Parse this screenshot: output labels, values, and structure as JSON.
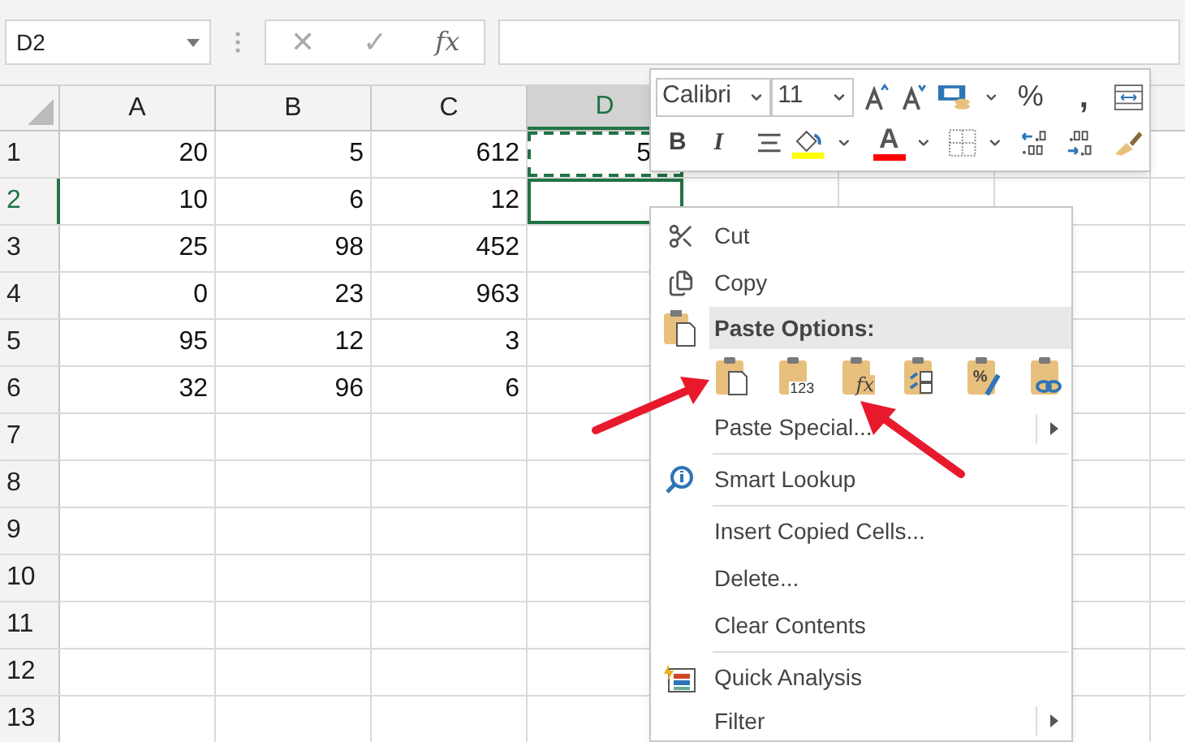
{
  "name_box": {
    "value": "D2"
  },
  "formula_bar": {
    "cancel": "✕",
    "enter": "✓",
    "function": "fx"
  },
  "columns": [
    {
      "label": "A",
      "selected": false
    },
    {
      "label": "B",
      "selected": false
    },
    {
      "label": "C",
      "selected": false
    },
    {
      "label": "D",
      "selected": true
    }
  ],
  "rows": [
    {
      "label": "1",
      "selected": false,
      "cells": [
        {
          "value": "20"
        },
        {
          "value": "5"
        },
        {
          "value": "612"
        },
        {
          "value": "5",
          "copied": true
        }
      ]
    },
    {
      "label": "2",
      "selected": true,
      "cells": [
        {
          "value": "10"
        },
        {
          "value": "6"
        },
        {
          "value": "12"
        },
        {
          "active": true
        }
      ]
    },
    {
      "label": "3",
      "selected": false,
      "cells": [
        {
          "value": "25"
        },
        {
          "value": "98"
        },
        {
          "value": "452"
        }
      ]
    },
    {
      "label": "4",
      "selected": false,
      "cells": [
        {
          "value": "0"
        },
        {
          "value": "23"
        },
        {
          "value": "963"
        }
      ]
    },
    {
      "label": "5",
      "selected": false,
      "cells": [
        {
          "value": "95"
        },
        {
          "value": "12"
        },
        {
          "value": "3"
        }
      ]
    },
    {
      "label": "6",
      "selected": false,
      "cells": [
        {
          "value": "32"
        },
        {
          "value": "96"
        },
        {
          "value": "6"
        }
      ]
    },
    {
      "label": "7",
      "selected": false
    },
    {
      "label": "8",
      "selected": false
    },
    {
      "label": "9",
      "selected": false
    },
    {
      "label": "10",
      "selected": false
    },
    {
      "label": "11",
      "selected": false
    },
    {
      "label": "12",
      "selected": false
    },
    {
      "label": "13",
      "selected": false
    }
  ],
  "mini_toolbar": {
    "font": "Calibri",
    "size": "11",
    "percent": "%",
    "comma": ",",
    "bold": "B",
    "italic": "I",
    "font_color": "A"
  },
  "context_menu": [
    {
      "kind": "cut",
      "label": "Cut"
    },
    {
      "kind": "copy",
      "label": "Copy"
    },
    {
      "kind": "header",
      "label": "Paste Options:"
    },
    {
      "kind": "paste_options",
      "options": [
        {
          "kind": "paste"
        },
        {
          "kind": "values",
          "glyph": "123"
        },
        {
          "kind": "formulas",
          "glyph": "fx"
        },
        {
          "kind": "transpose"
        },
        {
          "kind": "formatting",
          "glyph": "%"
        },
        {
          "kind": "link"
        }
      ]
    },
    {
      "kind": "submenu",
      "label": "Paste Special..."
    },
    {
      "kind": "divider"
    },
    {
      "kind": "lookup",
      "label": "Smart Lookup"
    },
    {
      "kind": "divider"
    },
    {
      "kind": "item",
      "label": "Insert Copied Cells..."
    },
    {
      "kind": "item",
      "label": "Delete..."
    },
    {
      "kind": "item",
      "label": "Clear Contents"
    },
    {
      "kind": "divider"
    },
    {
      "kind": "analysis",
      "label": "Quick Analysis"
    },
    {
      "kind": "submenu",
      "label": "Filter"
    }
  ]
}
